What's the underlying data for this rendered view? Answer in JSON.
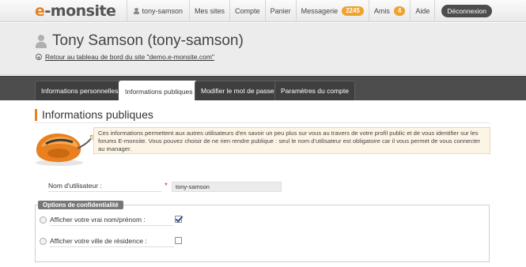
{
  "brand": {
    "logo_prefix": "e",
    "logo_rest": "-monsite"
  },
  "topnav": {
    "username": "tony-samson",
    "items": [
      "Mes sites",
      "Compte",
      "Panier"
    ],
    "messages_label": "Messagerie",
    "messages_count": "2245",
    "friends_label": "Amis",
    "friends_count": "4",
    "help_label": "Aide",
    "logout_label": "Déconnexion"
  },
  "header": {
    "title": "Tony Samson (tony-samson)",
    "back_link": "Retour au tableau de bord du site \"demo.e-monsite.com\""
  },
  "tabs": [
    {
      "label": "Informations personnelles",
      "active": false
    },
    {
      "label": "Informations publiques",
      "active": true
    },
    {
      "label": "Modifier le mot de passe",
      "active": false
    },
    {
      "label": "Paramètres du compte",
      "active": false
    }
  ],
  "section": {
    "title": "Informations publiques",
    "info_text": "Ces informations permettent aux autres utilisateurs d'en savoir un peu plus sur vous au travers de votre profil public et de vous identifier sur les forums E-monsite. Vous pouvez choisir de ne rien rendre publique : seul le nom d'utilisateur est obligatoire car il vous permet de vous connecter au manager."
  },
  "form": {
    "username_label": "Nom d'utilisateur :",
    "required_mark": "*",
    "username_value": "tony-samson",
    "privacy_legend": "Options de confidentialité",
    "options": [
      {
        "label": "Afficher votre vrai nom/prénom :",
        "checked": true
      },
      {
        "label": "Afficher votre ville de résidence :",
        "checked": false
      }
    ]
  },
  "colors": {
    "accent": "#e8801f",
    "badge": "#f0a22e",
    "tabs_bg": "#4d4d4d"
  }
}
